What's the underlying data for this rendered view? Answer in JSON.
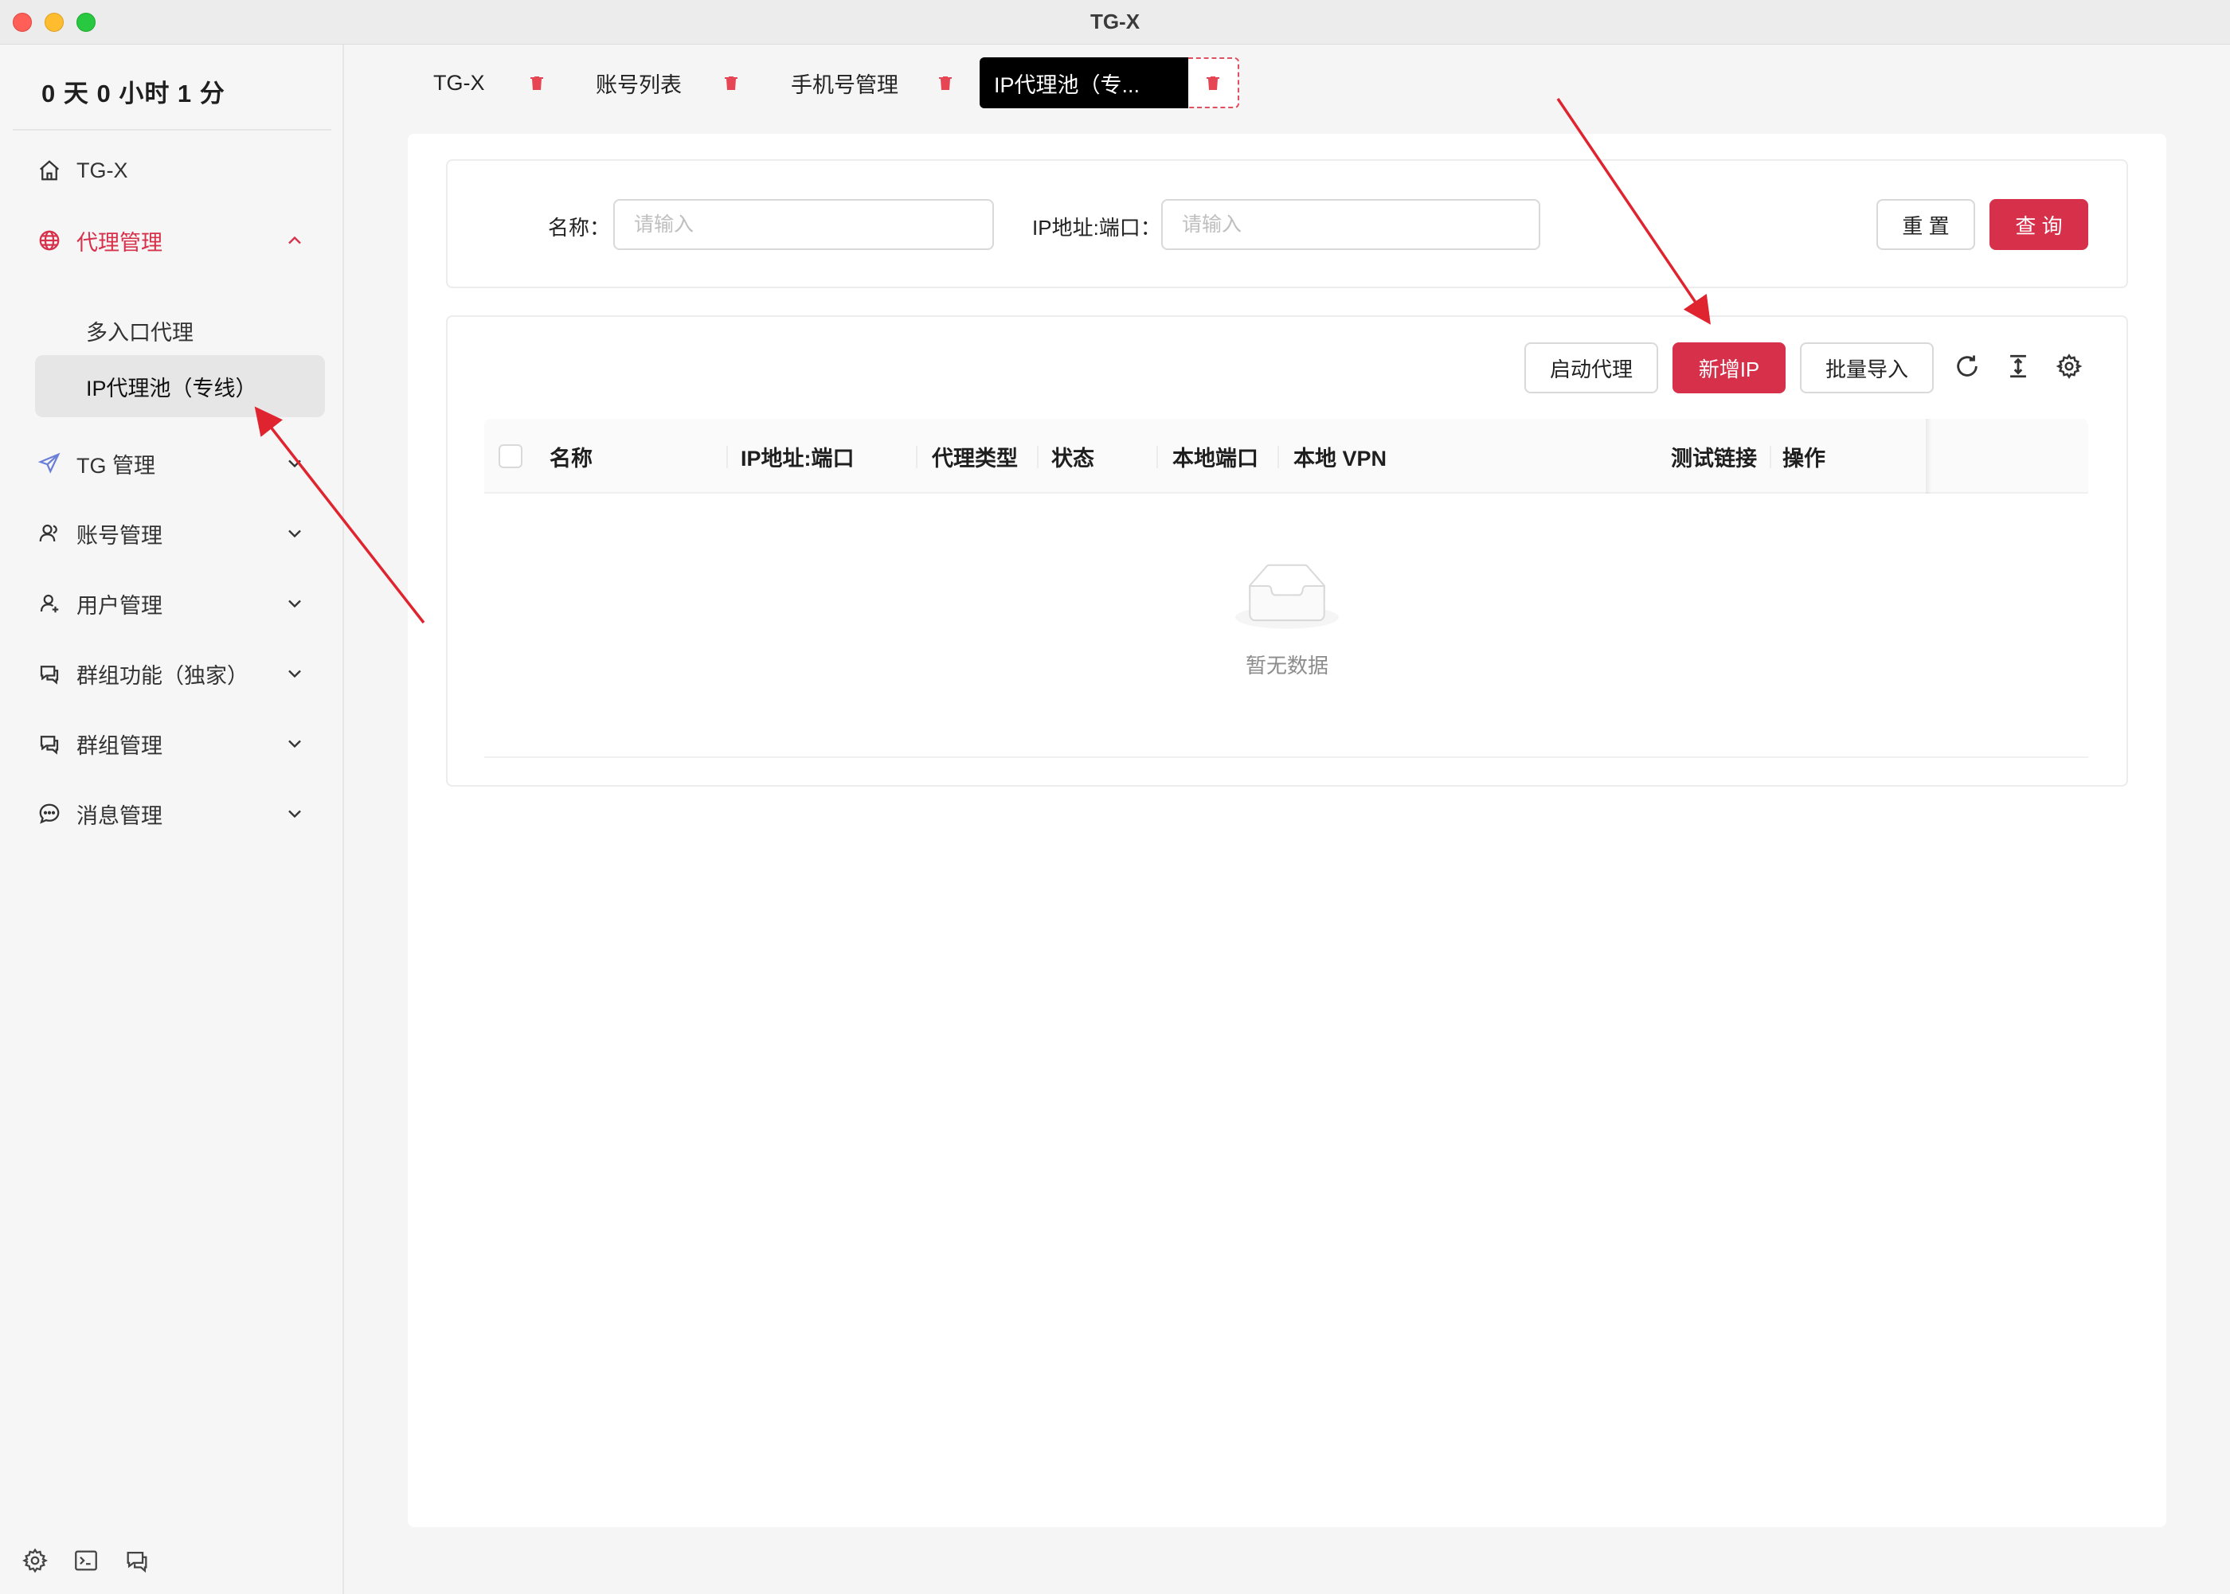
{
  "window": {
    "title": "TG-X"
  },
  "sidebar": {
    "uptime": "0 天 0 小时 1 分",
    "items": [
      {
        "label": "TG-X",
        "icon": "home-icon"
      },
      {
        "label": "代理管理",
        "icon": "globe-icon",
        "expanded": true
      },
      {
        "label": "TG 管理",
        "icon": "send-icon"
      },
      {
        "label": "账号管理",
        "icon": "users-icon"
      },
      {
        "label": "用户管理",
        "icon": "user-icon"
      },
      {
        "label": "群组功能（独家）",
        "icon": "chat-icon"
      },
      {
        "label": "群组管理",
        "icon": "chat-icon"
      },
      {
        "label": "消息管理",
        "icon": "message-icon"
      }
    ],
    "submenu": [
      {
        "label": "多入口代理"
      },
      {
        "label": "IP代理池（专线）",
        "selected": true
      }
    ],
    "bottom_icons": [
      "gear-icon",
      "terminal-icon",
      "chat-icon"
    ]
  },
  "tabs": [
    {
      "label": "TG-X"
    },
    {
      "label": "账号列表"
    },
    {
      "label": "手机号管理"
    },
    {
      "label": "IP代理池（专...",
      "active": true
    }
  ],
  "search": {
    "name_label": "名称：",
    "name_placeholder": "请输入",
    "ip_label": "IP地址:端口：",
    "ip_placeholder": "请输入",
    "reset_label": "重 置",
    "query_label": "查 询"
  },
  "toolbar": {
    "start_proxy": "启动代理",
    "add_ip": "新增IP",
    "batch_import": "批量导入",
    "icons": [
      "refresh-icon",
      "column-height-icon",
      "settings-icon"
    ]
  },
  "table": {
    "columns": [
      "名称",
      "IP地址:端口",
      "代理类型",
      "状态",
      "本地端口",
      "本地 VPN",
      "测试链接",
      "操作"
    ],
    "rows": [],
    "empty_text": "暂无数据"
  },
  "colors": {
    "accent": "#d6304a",
    "annotation_arrow": "#e0242f"
  }
}
